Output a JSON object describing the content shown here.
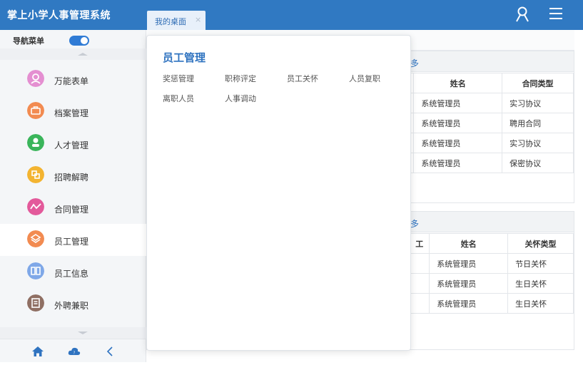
{
  "header": {
    "app_title": "掌上小学人事管理系统",
    "tab_label": "我的桌面",
    "tab_close": "×"
  },
  "sidebar": {
    "nav_toggle_label": "导航菜单",
    "items": [
      {
        "label": "万能表单",
        "icon": "user-icon",
        "color": "#e48fd1"
      },
      {
        "label": "档案管理",
        "icon": "briefcase-icon",
        "color": "#f28b51"
      },
      {
        "label": "人才管理",
        "icon": "person-icon",
        "color": "#3ab55b"
      },
      {
        "label": "招聘解聘",
        "icon": "recruit-icon",
        "color": "#f3b431"
      },
      {
        "label": "合同管理",
        "icon": "contract-icon",
        "color": "#e35a9b"
      },
      {
        "label": "员工管理",
        "icon": "layers-icon",
        "color": "#f28b51"
      },
      {
        "label": "员工信息",
        "icon": "book-icon",
        "color": "#7fa8e8"
      },
      {
        "label": "外聘兼职",
        "icon": "document-icon",
        "color": "#8f6f63"
      }
    ]
  },
  "mega_menu": {
    "title": "员工管理",
    "links": [
      "奖惩管理",
      "职称评定",
      "员工关怀",
      "人员复职",
      "离职人员",
      "人事调动"
    ]
  },
  "panel1": {
    "more": "多",
    "headers": [
      "姓名",
      "合同类型"
    ],
    "rows": [
      [
        "系统管理员",
        "实习协议"
      ],
      [
        "系统管理员",
        "聘用合同"
      ],
      [
        "系统管理员",
        "实习协议"
      ],
      [
        "系统管理员",
        "保密协议"
      ]
    ]
  },
  "panel2": {
    "more": "多",
    "col0": "工",
    "headers": [
      "姓名",
      "关怀类型"
    ],
    "rows": [
      [
        "系统管理员",
        "节日关怀"
      ],
      [
        "系统管理员",
        "生日关怀"
      ],
      [
        "系统管理员",
        "生日关怀"
      ]
    ]
  },
  "colors": {
    "topbar": "#3079c2",
    "accent": "#2f73c0"
  }
}
